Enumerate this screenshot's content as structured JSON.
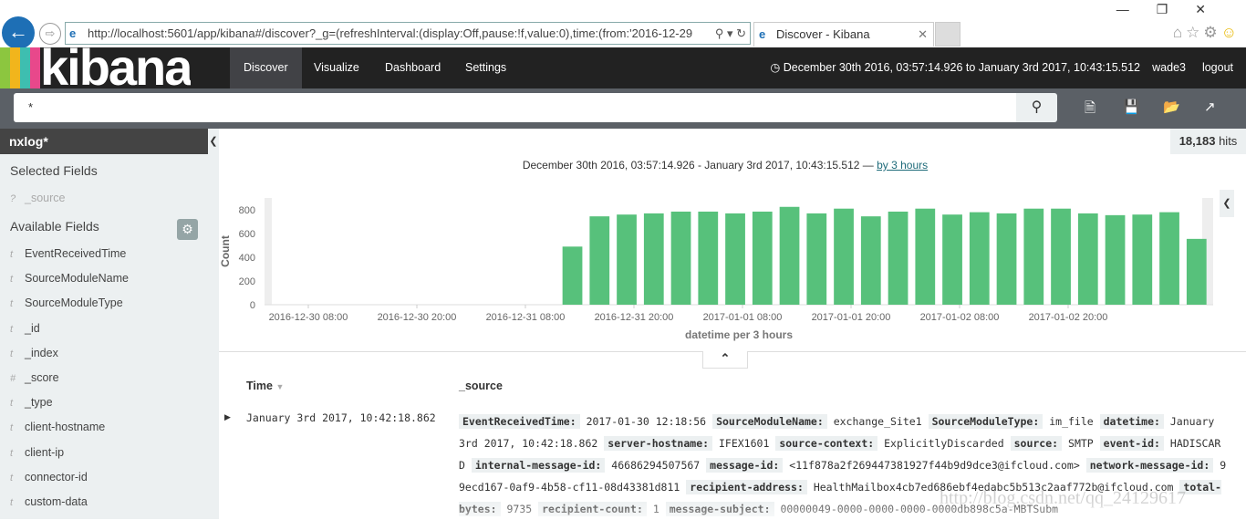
{
  "browser": {
    "url": "http://localhost:5601/app/kibana#/discover?_g=(refreshInterval:(display:Off,pause:!f,value:0),time:(from:'2016-12-29",
    "tab_title": "Discover - Kibana"
  },
  "nav": {
    "logo": "kibana",
    "items": [
      "Discover",
      "Visualize",
      "Dashboard",
      "Settings"
    ],
    "active": "Discover",
    "time_range": "December 30th 2016, 03:57:14.926 to January 3rd 2017, 10:43:15.512",
    "user": "wade3",
    "logout": "logout",
    "stripe_colors": [
      "#8cc63f",
      "#f1b51c",
      "#3ebeb0",
      "#e8488b"
    ]
  },
  "search": {
    "query": "*"
  },
  "sidebar": {
    "index": "nxlog*",
    "selected_heading": "Selected Fields",
    "selected_fields": [
      {
        "type": "?",
        "name": "_source"
      }
    ],
    "available_heading": "Available Fields",
    "fields": [
      {
        "type": "t",
        "name": "EventReceivedTime"
      },
      {
        "type": "t",
        "name": "SourceModuleName"
      },
      {
        "type": "t",
        "name": "SourceModuleType"
      },
      {
        "type": "t",
        "name": "_id"
      },
      {
        "type": "t",
        "name": "_index"
      },
      {
        "type": "#",
        "name": "_score"
      },
      {
        "type": "t",
        "name": "_type"
      },
      {
        "type": "t",
        "name": "client-hostname"
      },
      {
        "type": "t",
        "name": "client-ip"
      },
      {
        "type": "t",
        "name": "connector-id"
      },
      {
        "type": "t",
        "name": "custom-data"
      }
    ]
  },
  "hits": {
    "count": "18,183",
    "label": "hits"
  },
  "chart_header": {
    "range": "December 30th 2016, 03:57:14.926 - January 3rd 2017, 10:43:15.512 —",
    "interval_link": "by 3 hours"
  },
  "chart_data": {
    "type": "bar",
    "xlabel": "datetime per 3 hours",
    "ylabel": "Count",
    "ylim": [
      0,
      900
    ],
    "yticks": [
      0,
      200,
      400,
      600,
      800
    ],
    "xticks": [
      "2016-12-30 08:00",
      "2016-12-30 20:00",
      "2016-12-31 08:00",
      "2016-12-31 20:00",
      "2017-01-01 08:00",
      "2017-01-01 20:00",
      "2017-01-02 08:00",
      "2017-01-02 20:00"
    ],
    "xrange": [
      "2016-12-30 03:57",
      "2017-01-03 10:43"
    ],
    "bar_color": "#57c17b",
    "first_bucket": "2016-12-31 12:00",
    "bucket_hours": 3,
    "values": [
      490,
      745,
      760,
      770,
      785,
      785,
      770,
      785,
      825,
      770,
      810,
      745,
      785,
      810,
      760,
      780,
      770,
      810,
      810,
      770,
      755,
      760,
      780,
      555
    ]
  },
  "table": {
    "headers": [
      "Time",
      "_source"
    ],
    "rows": [
      {
        "time": "January 3rd 2017, 10:42:18.862",
        "source": [
          [
            "EventReceivedTime:",
            "2017-01-30 12:18:56"
          ],
          [
            "SourceModuleName:",
            "exchange_Site1"
          ],
          [
            "SourceModuleType:",
            "im_file"
          ],
          [
            "datetime:",
            "January 3rd 2017, 10:42:18.862"
          ],
          [
            "server-hostname:",
            "IFEX1601"
          ],
          [
            "source-context:",
            "ExplicitlyDiscarded"
          ],
          [
            "source:",
            "SMTP"
          ],
          [
            "event-id:",
            "HADISCARD"
          ],
          [
            "internal-message-id:",
            "46686294507567"
          ],
          [
            "message-id:",
            "<11f878a2f269447381927f44b9d9dce3@ifcloud.com>"
          ],
          [
            "network-message-id:",
            "99ecd167-0af9-4b58-cf11-08d43381d811"
          ],
          [
            "recipient-address:",
            "HealthMailbox4cb7ed686ebf4edabc5b513c2aaf772b@ifcloud.com"
          ],
          [
            "total-bytes:",
            "9735"
          ],
          [
            "recipient-count:",
            "1"
          ],
          [
            "message-subject:",
            "00000049-0000-0000-0000-0000db898c5a-MBTSubm"
          ]
        ]
      }
    ]
  },
  "watermark": "http://blog.csdn.net/qq_24129617"
}
